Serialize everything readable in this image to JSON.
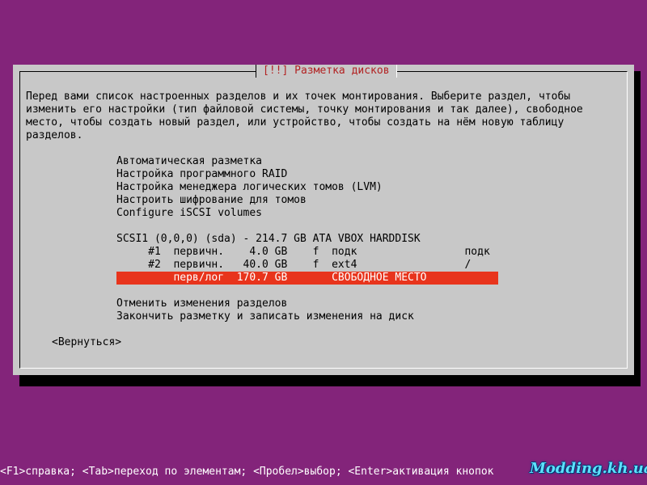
{
  "dialog": {
    "title": "[!!] Разметка дисков",
    "intro_lines": [
      "Перед вами список настроенных разделов и их точек монтирования. Выберите раздел, чтобы",
      "изменить его настройки (тип файловой системы, точку монтирования и так далее), свободное",
      "место, чтобы создать новый раздел, или устройство, чтобы создать на нём новую таблицу",
      "разделов."
    ],
    "menu_items": [
      "Автоматическая разметка",
      "Настройка программного RAID",
      "Настройка менеджера логических томов (LVM)",
      "Настроить шифрование для томов",
      "Configure iSCSI volumes"
    ],
    "disk": "SCSI1 (0,0,0) (sda) - 214.7 GB ATA VBOX HARDDISK",
    "partitions": [
      "     #1  первичн.    4.0 GB    f  подк                 подк",
      "     #2  первичн.   40.0 GB    f  ext4                 /"
    ],
    "free_space_row": "         перв/лог  170.7 GB       СВОБОДНОЕ МЕСТО",
    "actions": [
      "Отменить изменения разделов",
      "Закончить разметку и записать изменения на диск"
    ],
    "back_button": "<Вернуться>"
  },
  "footer": "<F1>справка; <Tab>переход по элементам; <Пробел>выбор; <Enter>активация кнопок",
  "watermark": "Modding.kh.ua",
  "colors": {
    "background": "#83247a",
    "dialog": "#c8c8c8",
    "title_text": "#b22222",
    "selection": "#e8341c"
  }
}
